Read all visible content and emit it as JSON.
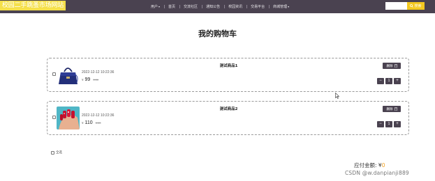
{
  "header": {
    "brand": "校园二手跳蚤市场网站",
    "nav": [
      {
        "label": "用户",
        "has_caret": true
      },
      {
        "label": "首页",
        "has_caret": false
      },
      {
        "label": "交流社区",
        "has_caret": false
      },
      {
        "label": "通知公告",
        "has_caret": false
      },
      {
        "label": "校园资讯",
        "has_caret": false
      },
      {
        "label": "交易平台",
        "has_caret": false
      },
      {
        "label": "商城管理",
        "has_caret": true
      }
    ],
    "search_placeholder": "",
    "search_label": "搜索"
  },
  "page_title": "我的购物车",
  "cart": {
    "items": [
      {
        "name": "测试商品1",
        "date": "2022-12-12 10:22:36",
        "currency": "¥",
        "price": "99",
        "old_price": "0.00",
        "quantity": "1",
        "delete_label": "删除",
        "image": "handbag"
      },
      {
        "name": "测试商品2",
        "date": "2022-12-12 10:22:36",
        "currency": "¥",
        "price": "110",
        "old_price": "0.00",
        "quantity": "1",
        "delete_label": "删除",
        "image": "nail-art"
      }
    ],
    "select_all_label": "全选",
    "total_label": "应付金额: ¥",
    "total_value": "0"
  },
  "watermark": "CSDN @w.danpianji889",
  "colors": {
    "nav_bg": "#4a4250",
    "brand_bg": "#f5e04a",
    "search_btn": "#f3c820",
    "amount": "#f0a020"
  }
}
